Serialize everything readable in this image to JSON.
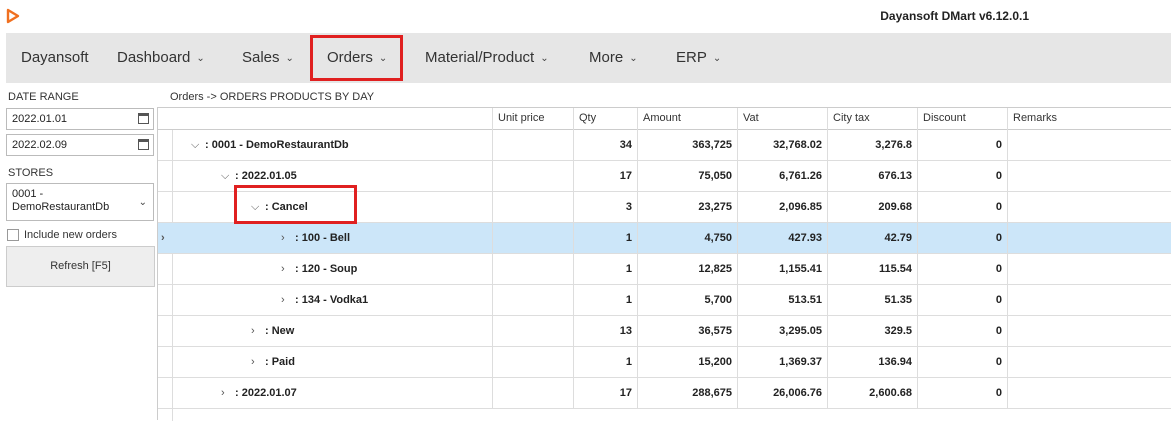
{
  "app": {
    "title": "Dayansoft DMart v6.12.0.1",
    "logo_icon": "play-logo-icon",
    "accent": "#f07020"
  },
  "menu": {
    "items": [
      {
        "label": "Dayansoft",
        "chevron": false
      },
      {
        "label": "Dashboard",
        "chevron": true
      },
      {
        "label": "Sales",
        "chevron": true
      },
      {
        "label": "Orders",
        "chevron": true
      },
      {
        "label": "Material/Product",
        "chevron": true
      },
      {
        "label": "More",
        "chevron": true
      },
      {
        "label": "ERP",
        "chevron": true
      }
    ],
    "highlight_color": "#e02020"
  },
  "filters": {
    "date_range_label": "DATE RANGE",
    "date_from": "2022.01.01",
    "date_to": "2022.02.09",
    "stores_label": "STORES",
    "store_line1": "0001 -",
    "store_line2": "DemoRestaurantDb",
    "include_new_orders": "Include new orders",
    "refresh": "Refresh [F5]"
  },
  "breadcrumb": "Orders -> ORDERS PRODUCTS BY DAY",
  "table": {
    "columns": [
      "Unit price",
      "Qty",
      "Amount",
      "Vat",
      "City tax",
      "Discount",
      "Remarks"
    ],
    "rows": [
      {
        "label": ": 0001 - DemoRestaurantDb",
        "expander": "⌵",
        "qty": "34",
        "amount": "363,725",
        "vat": "32,768.02",
        "city_tax": "3,276.8",
        "discount": "0"
      },
      {
        "label": ": 2022.01.05",
        "expander": "⌵",
        "qty": "17",
        "amount": "75,050",
        "vat": "6,761.26",
        "city_tax": "676.13",
        "discount": "0"
      },
      {
        "label": ": Cancel",
        "expander": "⌵",
        "qty": "3",
        "amount": "23,275",
        "vat": "2,096.85",
        "city_tax": "209.68",
        "discount": "0"
      },
      {
        "label": ": 100 - Bell",
        "expander": "›",
        "qty": "1",
        "amount": "4,750",
        "vat": "427.93",
        "city_tax": "42.79",
        "discount": "0"
      },
      {
        "label": ": 120 - Soup",
        "expander": "›",
        "qty": "1",
        "amount": "12,825",
        "vat": "1,155.41",
        "city_tax": "115.54",
        "discount": "0"
      },
      {
        "label": ": 134 - Vodka1",
        "expander": "›",
        "qty": "1",
        "amount": "5,700",
        "vat": "513.51",
        "city_tax": "51.35",
        "discount": "0"
      },
      {
        "label": ": New",
        "expander": "›",
        "qty": "13",
        "amount": "36,575",
        "vat": "3,295.05",
        "city_tax": "329.5",
        "discount": "0"
      },
      {
        "label": ": Paid",
        "expander": "›",
        "qty": "1",
        "amount": "15,200",
        "vat": "1,369.37",
        "city_tax": "136.94",
        "discount": "0"
      },
      {
        "label": ": 2022.01.07",
        "expander": "›",
        "qty": "17",
        "amount": "288,675",
        "vat": "26,006.76",
        "city_tax": "2,600.68",
        "discount": "0"
      }
    ],
    "selected_row_marker": "›",
    "selected_color": "#cce6f9"
  }
}
